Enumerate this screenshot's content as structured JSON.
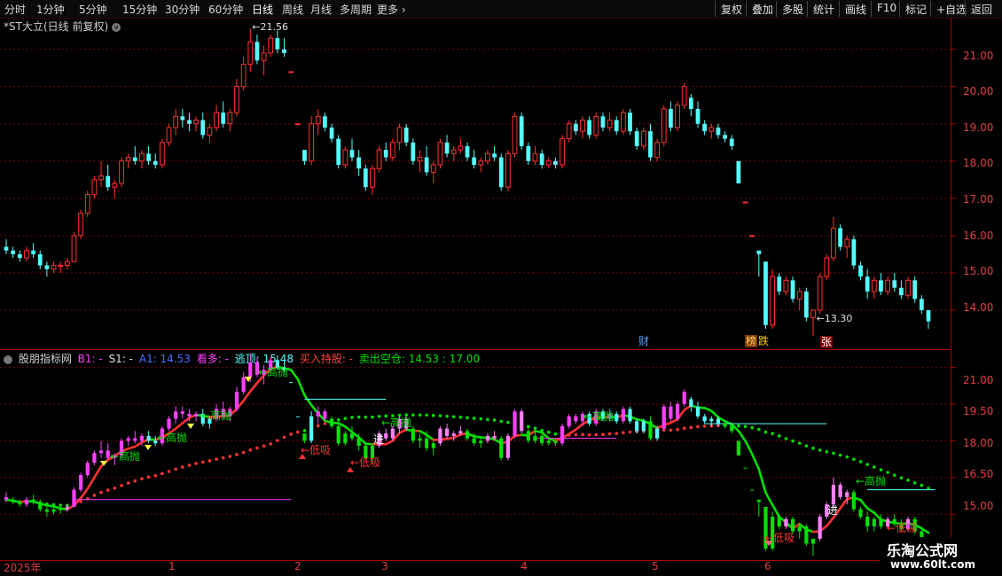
{
  "toolbar": {
    "periods": [
      "分时",
      "1分钟",
      "5分钟",
      "15分钟",
      "30分钟",
      "60分钟",
      "日线",
      "周线",
      "月线",
      "多周期",
      "更多"
    ],
    "active_period": "日线",
    "right_buttons": [
      "复权",
      "叠加",
      "多股",
      "统计",
      "画线",
      "F10",
      "标记",
      "+自选",
      "返回"
    ]
  },
  "main_chart": {
    "title": "*ST大立(日线 前复权)",
    "y_ticks": [
      "21.00",
      "20.00",
      "19.00",
      "18.00",
      "17.00",
      "16.00",
      "15.00",
      "14.00"
    ],
    "high_label": "21.56",
    "low_label": "13.30",
    "markers": {
      "cai": "财",
      "bang": "榜",
      "die": "跌",
      "zhang": "张"
    }
  },
  "indicator": {
    "name": "股朋指标网",
    "b1": "B1: -",
    "s1": "S1: -",
    "a1": "A1: 14.53",
    "kanduo": "看多: -",
    "taoding": "逃顶: 15.48",
    "mairu": "买入持股: -",
    "maichu": "卖出空仓: 14.53 : 17.00",
    "y_ticks": [
      "21.00",
      "19.50",
      "18.00",
      "16.50",
      "15.00"
    ],
    "labels": {
      "gaopao": "高抛",
      "dixi": "低吸",
      "jin": "进"
    }
  },
  "x_axis": {
    "labels": [
      "2025年",
      "1",
      "2",
      "3",
      "4",
      "5",
      "6"
    ]
  },
  "watermark": {
    "line1": "乐淘公式网",
    "line2": "www.60lt.com"
  },
  "colors": {
    "up": "#ff3232",
    "down": "#54ffff",
    "grid": "#7a0000",
    "axis": "#e04040",
    "green_line": "#00e000",
    "pink": "#ff40ff"
  },
  "chart_data": {
    "type": "candlestick",
    "dates": [
      "2024-12-23",
      "2025-01-02",
      "2025-02-05",
      "2025-03-03",
      "2025-04-01",
      "2025-05-06",
      "2025-06-03"
    ],
    "candles": [
      [
        15.7,
        15.9,
        15.5,
        15.6
      ],
      [
        15.6,
        15.7,
        15.4,
        15.5
      ],
      [
        15.5,
        15.6,
        15.3,
        15.4
      ],
      [
        15.4,
        15.7,
        15.3,
        15.6
      ],
      [
        15.6,
        15.8,
        15.4,
        15.5
      ],
      [
        15.5,
        15.6,
        15.1,
        15.2
      ],
      [
        15.2,
        15.3,
        14.9,
        15.1
      ],
      [
        15.1,
        15.3,
        15.0,
        15.2
      ],
      [
        15.2,
        15.3,
        15.0,
        15.2
      ],
      [
        15.2,
        15.4,
        15.1,
        15.3
      ],
      [
        15.3,
        16.1,
        15.3,
        16.0
      ],
      [
        16.0,
        16.7,
        15.9,
        16.6
      ],
      [
        16.6,
        17.2,
        16.5,
        17.1
      ],
      [
        17.1,
        17.6,
        17.0,
        17.5
      ],
      [
        17.5,
        18.0,
        17.3,
        17.6
      ],
      [
        17.6,
        17.9,
        17.2,
        17.3
      ],
      [
        17.3,
        17.5,
        17.0,
        17.4
      ],
      [
        17.4,
        18.1,
        17.3,
        18.0
      ],
      [
        18.0,
        18.2,
        17.8,
        18.1
      ],
      [
        18.1,
        18.4,
        17.9,
        18.0
      ],
      [
        18.0,
        18.3,
        17.8,
        18.2
      ],
      [
        18.2,
        18.4,
        17.9,
        18.0
      ],
      [
        18.0,
        18.2,
        17.8,
        17.9
      ],
      [
        17.9,
        18.6,
        17.8,
        18.5
      ],
      [
        18.5,
        19.0,
        18.4,
        18.9
      ],
      [
        18.9,
        19.4,
        18.7,
        19.2
      ],
      [
        19.2,
        19.4,
        18.9,
        19.1
      ],
      [
        19.1,
        19.3,
        18.8,
        19.0
      ],
      [
        19.0,
        19.2,
        18.8,
        19.1
      ],
      [
        19.1,
        19.3,
        18.6,
        18.7
      ],
      [
        18.7,
        19.0,
        18.5,
        18.9
      ],
      [
        18.9,
        19.5,
        18.8,
        19.3
      ],
      [
        19.3,
        19.6,
        18.9,
        19.0
      ],
      [
        19.0,
        19.4,
        18.8,
        19.3
      ],
      [
        19.3,
        20.2,
        19.2,
        20.0
      ],
      [
        20.0,
        20.8,
        19.9,
        20.6
      ],
      [
        20.6,
        21.56,
        20.4,
        21.2
      ],
      [
        21.2,
        21.4,
        20.6,
        20.7
      ],
      [
        20.7,
        21.1,
        20.3,
        20.9
      ],
      [
        20.9,
        21.4,
        20.8,
        21.3
      ],
      [
        21.3,
        21.5,
        20.9,
        21.0
      ],
      [
        21.0,
        21.3,
        20.8,
        20.9
      ],
      [
        20.4,
        20.4,
        20.4,
        20.4
      ],
      [
        19.0,
        19.0,
        19.0,
        19.0
      ],
      [
        18.3,
        18.0,
        17.9,
        18.0
      ],
      [
        18.0,
        19.2,
        17.9,
        19.0
      ],
      [
        19.0,
        19.4,
        18.7,
        19.2
      ],
      [
        19.2,
        19.3,
        18.8,
        18.9
      ],
      [
        18.9,
        19.0,
        18.5,
        18.6
      ],
      [
        18.6,
        18.7,
        17.8,
        17.9
      ],
      [
        17.9,
        18.4,
        17.8,
        18.3
      ],
      [
        18.3,
        18.6,
        18.0,
        18.1
      ],
      [
        18.1,
        18.3,
        17.6,
        17.8
      ],
      [
        17.8,
        17.9,
        17.2,
        17.3
      ],
      [
        17.3,
        17.9,
        17.1,
        17.8
      ],
      [
        17.8,
        18.4,
        17.7,
        18.3
      ],
      [
        18.3,
        18.5,
        18.0,
        18.1
      ],
      [
        18.1,
        18.6,
        18.0,
        18.5
      ],
      [
        18.5,
        19.0,
        18.3,
        18.9
      ],
      [
        18.9,
        19.0,
        18.4,
        18.5
      ],
      [
        18.5,
        18.6,
        17.9,
        18.0
      ],
      [
        18.0,
        18.3,
        17.7,
        18.1
      ],
      [
        18.1,
        18.4,
        17.6,
        17.7
      ],
      [
        17.7,
        18.0,
        17.4,
        17.9
      ],
      [
        17.9,
        18.6,
        17.8,
        18.5
      ],
      [
        18.5,
        18.7,
        18.1,
        18.2
      ],
      [
        18.2,
        18.4,
        18.0,
        18.3
      ],
      [
        18.3,
        18.6,
        18.2,
        18.4
      ],
      [
        18.4,
        18.5,
        18.0,
        18.1
      ],
      [
        18.1,
        18.3,
        17.8,
        17.9
      ],
      [
        17.9,
        18.1,
        17.7,
        18.0
      ],
      [
        18.0,
        18.3,
        17.9,
        18.2
      ],
      [
        18.2,
        18.4,
        18.0,
        18.1
      ],
      [
        18.1,
        18.2,
        17.2,
        17.3
      ],
      [
        17.3,
        18.3,
        17.2,
        18.2
      ],
      [
        18.2,
        19.3,
        18.1,
        19.2
      ],
      [
        19.2,
        19.3,
        18.3,
        18.4
      ],
      [
        18.4,
        18.5,
        17.9,
        18.0
      ],
      [
        18.0,
        18.4,
        17.9,
        18.2
      ],
      [
        18.2,
        18.3,
        17.8,
        17.9
      ],
      [
        17.9,
        18.1,
        17.8,
        18.0
      ],
      [
        18.0,
        18.1,
        17.8,
        17.9
      ],
      [
        17.9,
        18.7,
        17.8,
        18.6
      ],
      [
        18.6,
        19.1,
        18.5,
        19.0
      ],
      [
        19.0,
        19.1,
        18.7,
        18.8
      ],
      [
        18.8,
        19.2,
        18.6,
        19.1
      ],
      [
        19.1,
        19.2,
        18.6,
        18.7
      ],
      [
        18.7,
        19.3,
        18.6,
        19.2
      ],
      [
        19.2,
        19.3,
        18.8,
        18.9
      ],
      [
        18.9,
        19.3,
        18.8,
        19.1
      ],
      [
        19.1,
        19.2,
        18.7,
        18.8
      ],
      [
        18.8,
        19.4,
        18.7,
        19.3
      ],
      [
        19.3,
        19.4,
        18.7,
        18.8
      ],
      [
        18.8,
        18.9,
        18.3,
        18.4
      ],
      [
        18.4,
        18.9,
        18.3,
        18.8
      ],
      [
        18.8,
        19.0,
        18.0,
        18.1
      ],
      [
        18.1,
        18.6,
        18.0,
        18.5
      ],
      [
        18.5,
        19.5,
        18.4,
        19.4
      ],
      [
        19.4,
        19.6,
        18.8,
        18.9
      ],
      [
        18.9,
        19.6,
        18.8,
        19.5
      ],
      [
        19.5,
        20.1,
        19.4,
        20.0
      ],
      [
        19.7,
        19.8,
        19.2,
        19.4
      ],
      [
        19.4,
        19.6,
        18.9,
        19.0
      ],
      [
        19.0,
        19.1,
        18.7,
        18.8
      ],
      [
        18.8,
        19.0,
        18.6,
        18.9
      ],
      [
        18.9,
        19.0,
        18.6,
        18.7
      ],
      [
        18.7,
        18.8,
        18.5,
        18.6
      ],
      [
        18.6,
        18.7,
        18.3,
        18.4
      ],
      [
        18.0,
        18.0,
        17.4,
        17.4
      ],
      [
        16.9,
        16.9,
        16.9,
        16.9
      ],
      [
        16.0,
        16.0,
        16.0,
        16.0
      ],
      [
        15.6,
        15.5,
        14.9,
        15.5
      ],
      [
        15.3,
        15.3,
        13.5,
        13.6
      ],
      [
        13.6,
        15.1,
        13.5,
        14.9
      ],
      [
        14.9,
        15.0,
        14.4,
        14.5
      ],
      [
        14.5,
        14.9,
        14.4,
        14.8
      ],
      [
        14.8,
        14.9,
        14.2,
        14.3
      ],
      [
        14.3,
        14.6,
        14.0,
        14.5
      ],
      [
        14.5,
        14.6,
        13.7,
        13.8
      ],
      [
        13.8,
        14.0,
        13.3,
        14.0
      ],
      [
        14.0,
        15.0,
        13.9,
        14.9
      ],
      [
        14.9,
        15.5,
        14.8,
        15.4
      ],
      [
        15.4,
        16.5,
        15.3,
        16.2
      ],
      [
        16.2,
        16.3,
        15.6,
        15.7
      ],
      [
        15.7,
        16.0,
        15.4,
        15.9
      ],
      [
        15.9,
        16.0,
        15.1,
        15.2
      ],
      [
        15.2,
        15.3,
        14.8,
        14.9
      ],
      [
        14.9,
        15.1,
        14.3,
        14.5
      ],
      [
        14.5,
        14.9,
        14.3,
        14.8
      ],
      [
        14.8,
        15.0,
        14.4,
        14.5
      ],
      [
        14.5,
        14.9,
        14.4,
        14.8
      ],
      [
        14.8,
        15.0,
        14.5,
        14.6
      ],
      [
        14.6,
        14.8,
        14.3,
        14.4
      ],
      [
        14.4,
        14.9,
        14.3,
        14.8
      ],
      [
        14.8,
        14.9,
        14.2,
        14.3
      ],
      [
        14.3,
        14.4,
        13.9,
        14.0
      ],
      [
        14.0,
        14.0,
        13.5,
        13.7
      ]
    ],
    "ylim": [
      13.0,
      21.8
    ],
    "ma_indicator_ylim": [
      13.2,
      21.6
    ]
  }
}
